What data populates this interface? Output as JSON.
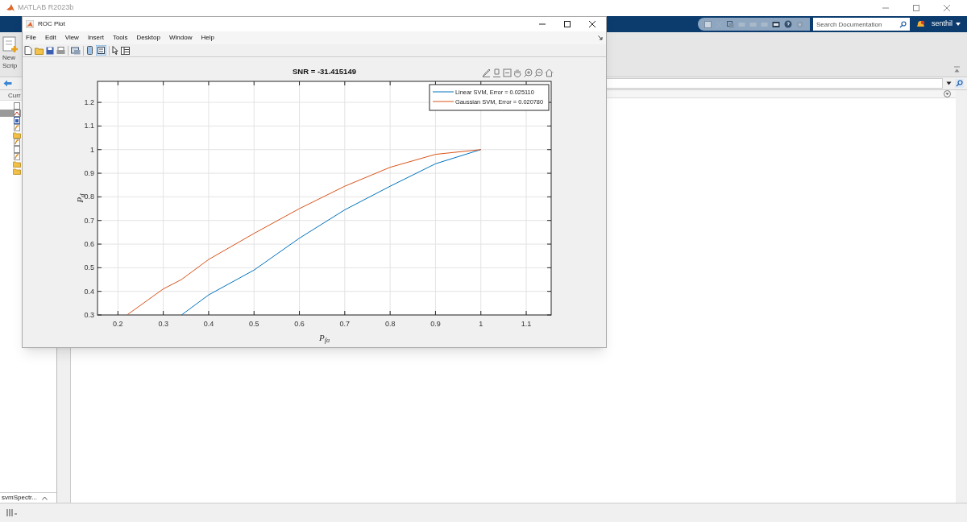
{
  "app": {
    "title": "MATLAB R2023b",
    "search": {
      "placeholder": "Search Documentation"
    },
    "user": "senthil",
    "new_script": [
      "New",
      "Scrip"
    ],
    "folder_header": "Curr",
    "folder_items": [
      {
        "kind": "blank",
        "selected": false
      },
      {
        "kind": "script",
        "selected": true
      },
      {
        "kind": "figure",
        "selected": false
      },
      {
        "kind": "function",
        "selected": false
      },
      {
        "kind": "folder",
        "selected": false
      },
      {
        "kind": "function",
        "selected": false
      },
      {
        "kind": "blank",
        "selected": false
      },
      {
        "kind": "function",
        "selected": false
      },
      {
        "kind": "folder",
        "selected": false
      },
      {
        "kind": "folder",
        "selected": false
      }
    ],
    "file_tab": "svmSpectr..."
  },
  "figure": {
    "title": "ROC Plot",
    "menu": [
      "File",
      "Edit",
      "View",
      "Insert",
      "Tools",
      "Desktop",
      "Window",
      "Help"
    ],
    "chart_data": {
      "type": "line",
      "title": "SNR = -31.415149",
      "xlabel": "P$_{fa}$",
      "ylabel": "P$_{d}$",
      "x": [
        0.22,
        0.3,
        0.34,
        0.4,
        0.5,
        0.6,
        0.7,
        0.8,
        0.9,
        1.0
      ],
      "series": [
        {
          "name": "Linear SVM, Error = 0.025110",
          "color": "#0072bd",
          "values": [
            null,
            null,
            0.3,
            0.385,
            0.49,
            0.625,
            0.745,
            0.845,
            0.94,
            1.0
          ]
        },
        {
          "name": "Gaussian SVM, Error = 0.020780",
          "color": "#d95319",
          "values": [
            0.3,
            0.41,
            0.45,
            0.535,
            0.645,
            0.75,
            0.845,
            0.925,
            0.98,
            1.0
          ]
        }
      ],
      "xlim": [
        0.155,
        1.155
      ],
      "ylim": [
        0.3,
        1.289
      ],
      "xticks": [
        0.2,
        0.3,
        0.4,
        0.5,
        0.6,
        0.7,
        0.8,
        0.9,
        1,
        1.1
      ],
      "yticks": [
        0.3,
        0.4,
        0.5,
        0.6,
        0.7,
        0.8,
        0.9,
        1,
        1.1,
        1.2
      ],
      "grid": true,
      "legend": true
    }
  }
}
